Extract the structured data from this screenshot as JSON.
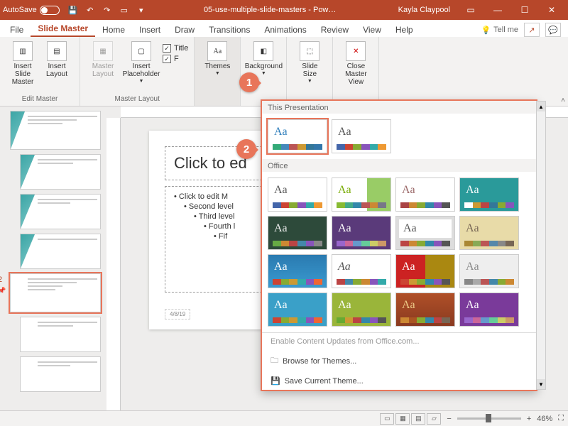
{
  "titlebar": {
    "autosave": "AutoSave",
    "docname": "05-use-multiple-slide-masters - Pow…",
    "user": "Kayla Claypool"
  },
  "tabs": {
    "file": "File",
    "slidemaster": "Slide Master",
    "home": "Home",
    "insert": "Insert",
    "draw": "Draw",
    "transitions": "Transitions",
    "animations": "Animations",
    "review": "Review",
    "view": "View",
    "help": "Help",
    "tellme": "Tell me"
  },
  "ribbon": {
    "insert_slide_master": "Insert Slide Master",
    "insert_layout": "Insert Layout",
    "edit_master_group": "Edit Master",
    "master_layout": "Master Layout",
    "insert_placeholder": "Insert Placeholder",
    "chk_title": "Title",
    "chk_footers": "F",
    "master_layout_group": "Master Layout",
    "themes": "Themes",
    "background": "Background",
    "slide_size": "Slide Size",
    "close_master": "Close Master View"
  },
  "slide": {
    "title_ph": "Click to ed",
    "b1": "• Click to edit M",
    "b2": "• Second level",
    "b3": "• Third level",
    "b4": "• Fourth l",
    "b5": "• Fif",
    "date": "4/8/19"
  },
  "thumbnails": {
    "master2_num": "2"
  },
  "flyout": {
    "sec1": "This Presentation",
    "sec2": "Office",
    "enable": "Enable Content Updates from Office.com...",
    "browse": "Browse for Themes...",
    "save": "Save Current Theme...",
    "aa": "Aa"
  },
  "status": {
    "zoom": "46%"
  },
  "callouts": {
    "n1": "1",
    "n2": "2"
  }
}
